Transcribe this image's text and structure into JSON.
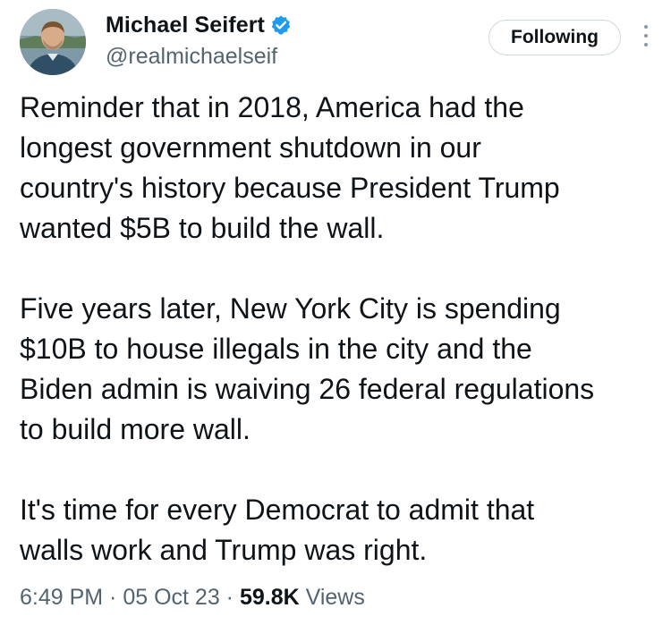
{
  "author": {
    "display_name": "Michael Seifert",
    "handle": "@realmichaelseif",
    "verified": true,
    "verified_color": "#1d9bf0",
    "avatar_icon": "profile-photo"
  },
  "actions": {
    "follow_label": "Following",
    "more_icon": "vertical-ellipsis-icon"
  },
  "tweet": {
    "paragraphs": [
      "Reminder that in 2018, America had the\nlongest government shutdown in our\ncountry's history because President Trump\nwanted $5B to build the wall.",
      "Five years later, New York City is spending\n$10B to house illegals in the city and the\nBiden admin is waiving 26 federal regulations\nto build more wall.",
      "It's time for every Democrat to admit that\nwalls work and Trump was right."
    ]
  },
  "meta": {
    "time": "6:49 PM",
    "separator": " · ",
    "date": "05 Oct 23",
    "views_count": "59.8K",
    "views_label": " Views"
  }
}
